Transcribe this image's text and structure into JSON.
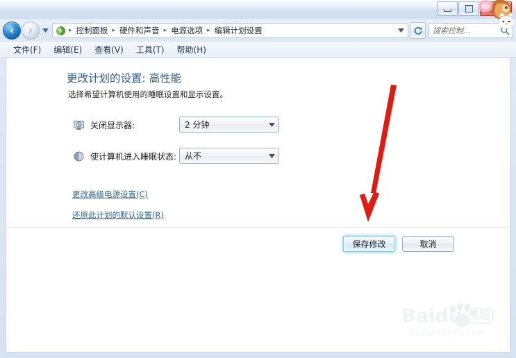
{
  "window": {
    "controls": {
      "minimize_label": "最小化",
      "maximize_label": "最大化",
      "close_label": "关闭"
    }
  },
  "addressbar": {
    "back_label": "后退",
    "forward_label": "前进",
    "history_label": "最近访问的位置",
    "refresh_label": "刷新",
    "crumb_icon": "control-panel-icon",
    "breadcrumbs": [
      "控制面板",
      "硬件和声音",
      "电源选项",
      "编辑计划设置"
    ],
    "separator": "▸"
  },
  "search": {
    "placeholder": "搜索控制...",
    "value": "",
    "icon": "search-icon"
  },
  "menubar": {
    "items": [
      "文件(F)",
      "编辑(E)",
      "查看(V)",
      "工具(T)",
      "帮助(H)"
    ]
  },
  "main": {
    "heading": "更改计划的设置: 高性能",
    "subheading": "选择希望计算机使用的睡眠设置和显示设置。",
    "settings": [
      {
        "icon": "monitor-clock-icon",
        "label": "关闭显示器:",
        "value": "2 分钟"
      },
      {
        "icon": "moon-sleep-icon",
        "label": "使计算机进入睡眠状态:",
        "value": "从不"
      }
    ],
    "links": [
      "更改高级电源设置(C)",
      "还原此计划的默认设置(R)"
    ],
    "buttons": {
      "save": "保存修改",
      "cancel": "取消"
    }
  },
  "watermark": {
    "brand": "Baidu",
    "badge": "经验",
    "url": "jingyan.baidu.com"
  },
  "annotation": {
    "arrow_color": "#e01b13",
    "arrow_target": "保存修改"
  },
  "colors": {
    "accent": "#2f5c87",
    "link": "#2a6496",
    "default_button_glow": "#82c8eb",
    "titlebar": "#d6e3f0"
  }
}
